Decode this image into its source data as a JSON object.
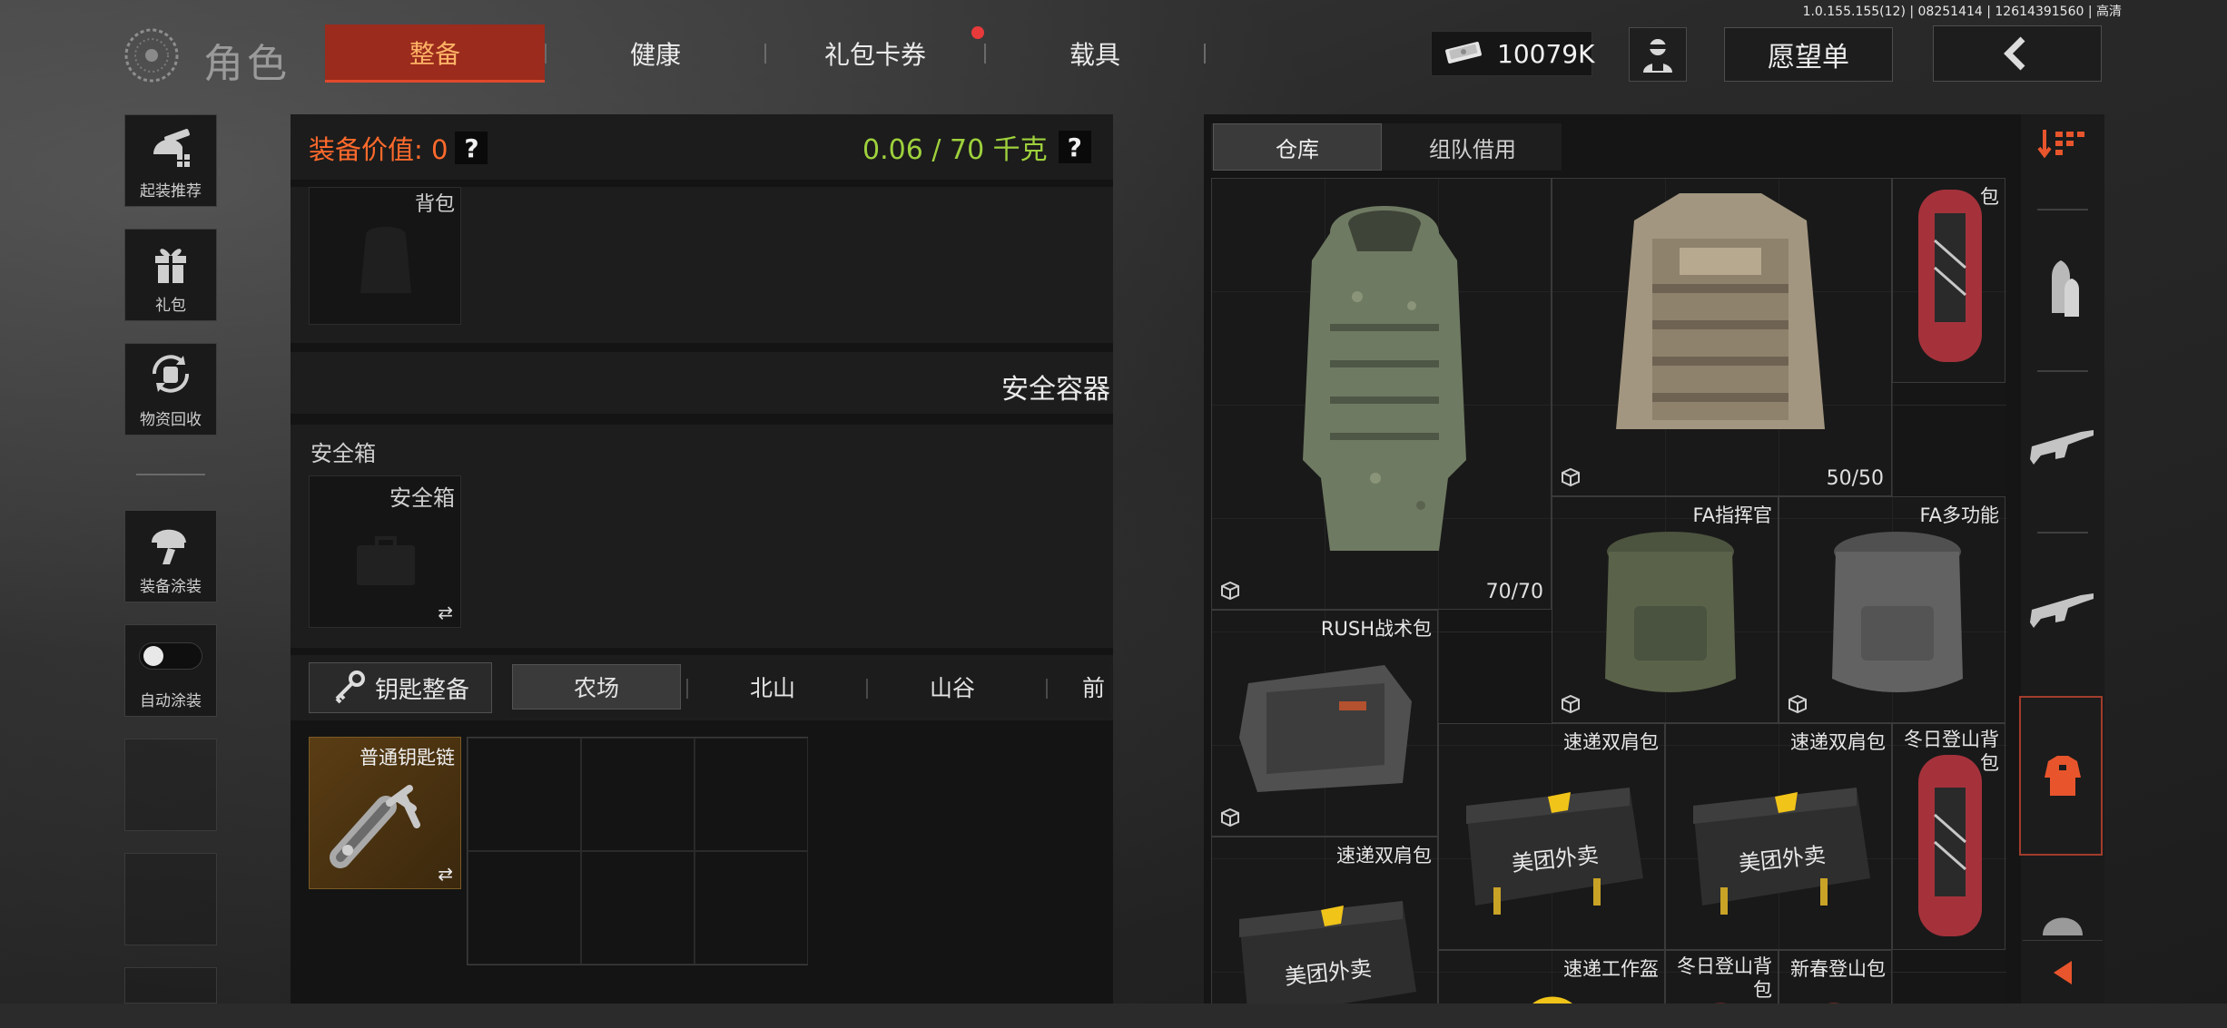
{
  "version": "1.0.155.155(12) | 08251414 | 12614391560 | 高清",
  "header": {
    "title": "角色",
    "tabs": [
      {
        "label": "整备",
        "active": true
      },
      {
        "label": "健康",
        "active": false
      },
      {
        "label": "礼包卡券",
        "active": false,
        "badge": true
      },
      {
        "label": "载具",
        "active": false
      }
    ],
    "money": "10079K",
    "wishlist_label": "愿望单"
  },
  "sidebar": {
    "items": [
      {
        "label": "起装推荐",
        "icon": "helmet-gun-icon"
      },
      {
        "label": "礼包",
        "icon": "gift-icon"
      },
      {
        "label": "物资回收",
        "icon": "recycle-icon"
      },
      {
        "label": "装备涂装",
        "icon": "paint-helmet-icon"
      },
      {
        "label": "自动涂装",
        "icon": "toggle-icon",
        "toggle_on": false
      }
    ]
  },
  "equipment": {
    "value_label": "装备价值: 0",
    "weight_label": "0.06 / 70 千克",
    "help_glyph": "?",
    "backpack_label": "背包",
    "secure_container_title": "安全容器",
    "safe_box_section": "安全箱",
    "safe_box_slot": "安全箱",
    "swap_glyph": "⇄",
    "key_button_label": "钥匙整备",
    "map_tabs": [
      {
        "label": "农场",
        "active": true
      },
      {
        "label": "北山",
        "active": false
      },
      {
        "label": "山谷",
        "active": false
      },
      {
        "label": "前",
        "active": false
      }
    ],
    "key_slot_label": "普通钥匙链"
  },
  "warehouse": {
    "tabs": [
      {
        "label": "仓库",
        "active": true
      },
      {
        "label": "组队借用",
        "active": false
      }
    ],
    "items": [
      {
        "name": "",
        "count": "70/70"
      },
      {
        "name": "",
        "count": "50/50"
      },
      {
        "name": "包",
        "count": ""
      },
      {
        "name": "FA指挥官",
        "count": ""
      },
      {
        "name": "FA多功能",
        "count": ""
      },
      {
        "name": "RUSH战术包",
        "count": ""
      },
      {
        "name": "速递双肩包",
        "count": ""
      },
      {
        "name": "速递双肩包",
        "count": ""
      },
      {
        "name": "冬日登山背包",
        "count": ""
      },
      {
        "name": "速递双肩包",
        "count": ""
      },
      {
        "name": "速递工作盔",
        "count": ""
      },
      {
        "name": "冬日登山背包",
        "count": ""
      },
      {
        "name": "新春登山包",
        "count": ""
      }
    ],
    "delivery_text": "美团外卖"
  },
  "categories": [
    "sort-icon",
    "ammo-icon",
    "rifle-icon",
    "rifle-icon",
    "backpack-icon",
    "arrow-left-icon"
  ],
  "colors": {
    "accent_red": "#9b2b1c",
    "value_orange": "#ff6a2c",
    "weight_green": "#9ed13c",
    "category_orange": "#e8552c"
  }
}
